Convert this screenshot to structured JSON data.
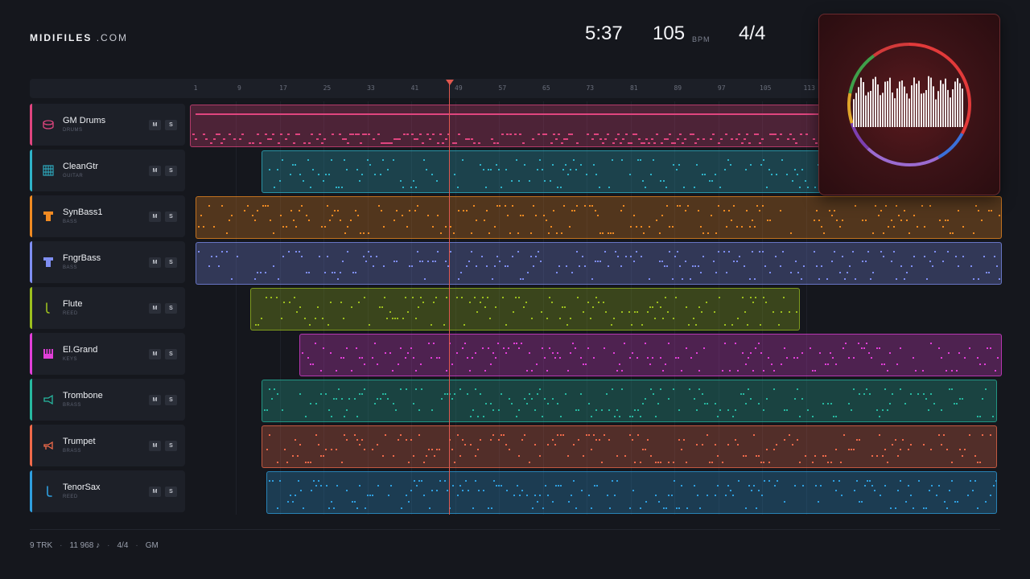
{
  "header": {
    "brand_main": "MIDIFILES",
    "brand_suffix": ".COM",
    "duration": "5:37",
    "tempo": "105",
    "tempo_unit": "BPM",
    "time_signature": "4/4"
  },
  "ruler": {
    "ticks": [
      "1",
      "9",
      "17",
      "25",
      "33",
      "41",
      "49",
      "57",
      "65",
      "73",
      "81",
      "89",
      "97",
      "105",
      "113"
    ]
  },
  "tracks": [
    {
      "name": "GM Drums",
      "category": "DRUMS",
      "color": "#e0457f",
      "icon": "drum-icon",
      "mute": "M",
      "solo": "S"
    },
    {
      "name": "CleanGtr",
      "category": "GUITAR",
      "color": "#2fb3c9",
      "icon": "guitar-icon",
      "mute": "M",
      "solo": "S"
    },
    {
      "name": "SynBass1",
      "category": "BASS",
      "color": "#f08a22",
      "icon": "bass-icon",
      "mute": "M",
      "solo": "S"
    },
    {
      "name": "FngrBass",
      "category": "BASS",
      "color": "#7f8ef2",
      "icon": "bass-icon",
      "mute": "M",
      "solo": "S"
    },
    {
      "name": "Flute",
      "category": "REED",
      "color": "#9cbf1e",
      "icon": "flute-icon",
      "mute": "M",
      "solo": "S"
    },
    {
      "name": "El.Grand",
      "category": "KEYS",
      "color": "#e23fd9",
      "icon": "piano-icon",
      "mute": "M",
      "solo": "S"
    },
    {
      "name": "Trombone",
      "category": "BRASS",
      "color": "#27b8a0",
      "icon": "trombone-icon",
      "mute": "M",
      "solo": "S"
    },
    {
      "name": "Trumpet",
      "category": "BRASS",
      "color": "#f06a4a",
      "icon": "trumpet-icon",
      "mute": "M",
      "solo": "S"
    },
    {
      "name": "TenorSax",
      "category": "REED",
      "color": "#2f9fe0",
      "icon": "sax-icon",
      "mute": "M",
      "solo": "S"
    }
  ],
  "playhead_bar": 48.4,
  "footer": {
    "tracks": "9 TRK",
    "notes": "11 968 ♪",
    "meter": "4/4",
    "standard": "GM"
  }
}
